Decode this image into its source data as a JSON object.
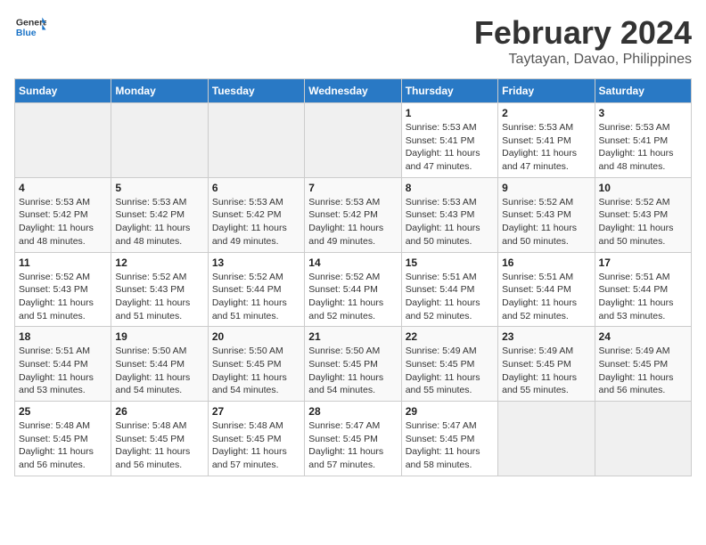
{
  "header": {
    "logo_general": "General",
    "logo_blue": "Blue",
    "month_title": "February 2024",
    "location": "Taytayan, Davao, Philippines"
  },
  "days_of_week": [
    "Sunday",
    "Monday",
    "Tuesday",
    "Wednesday",
    "Thursday",
    "Friday",
    "Saturday"
  ],
  "weeks": [
    [
      {
        "day": "",
        "info": ""
      },
      {
        "day": "",
        "info": ""
      },
      {
        "day": "",
        "info": ""
      },
      {
        "day": "",
        "info": ""
      },
      {
        "day": "1",
        "info": "Sunrise: 5:53 AM\nSunset: 5:41 PM\nDaylight: 11 hours\nand 47 minutes."
      },
      {
        "day": "2",
        "info": "Sunrise: 5:53 AM\nSunset: 5:41 PM\nDaylight: 11 hours\nand 47 minutes."
      },
      {
        "day": "3",
        "info": "Sunrise: 5:53 AM\nSunset: 5:41 PM\nDaylight: 11 hours\nand 48 minutes."
      }
    ],
    [
      {
        "day": "4",
        "info": "Sunrise: 5:53 AM\nSunset: 5:42 PM\nDaylight: 11 hours\nand 48 minutes."
      },
      {
        "day": "5",
        "info": "Sunrise: 5:53 AM\nSunset: 5:42 PM\nDaylight: 11 hours\nand 48 minutes."
      },
      {
        "day": "6",
        "info": "Sunrise: 5:53 AM\nSunset: 5:42 PM\nDaylight: 11 hours\nand 49 minutes."
      },
      {
        "day": "7",
        "info": "Sunrise: 5:53 AM\nSunset: 5:42 PM\nDaylight: 11 hours\nand 49 minutes."
      },
      {
        "day": "8",
        "info": "Sunrise: 5:53 AM\nSunset: 5:43 PM\nDaylight: 11 hours\nand 50 minutes."
      },
      {
        "day": "9",
        "info": "Sunrise: 5:52 AM\nSunset: 5:43 PM\nDaylight: 11 hours\nand 50 minutes."
      },
      {
        "day": "10",
        "info": "Sunrise: 5:52 AM\nSunset: 5:43 PM\nDaylight: 11 hours\nand 50 minutes."
      }
    ],
    [
      {
        "day": "11",
        "info": "Sunrise: 5:52 AM\nSunset: 5:43 PM\nDaylight: 11 hours\nand 51 minutes."
      },
      {
        "day": "12",
        "info": "Sunrise: 5:52 AM\nSunset: 5:43 PM\nDaylight: 11 hours\nand 51 minutes."
      },
      {
        "day": "13",
        "info": "Sunrise: 5:52 AM\nSunset: 5:44 PM\nDaylight: 11 hours\nand 51 minutes."
      },
      {
        "day": "14",
        "info": "Sunrise: 5:52 AM\nSunset: 5:44 PM\nDaylight: 11 hours\nand 52 minutes."
      },
      {
        "day": "15",
        "info": "Sunrise: 5:51 AM\nSunset: 5:44 PM\nDaylight: 11 hours\nand 52 minutes."
      },
      {
        "day": "16",
        "info": "Sunrise: 5:51 AM\nSunset: 5:44 PM\nDaylight: 11 hours\nand 52 minutes."
      },
      {
        "day": "17",
        "info": "Sunrise: 5:51 AM\nSunset: 5:44 PM\nDaylight: 11 hours\nand 53 minutes."
      }
    ],
    [
      {
        "day": "18",
        "info": "Sunrise: 5:51 AM\nSunset: 5:44 PM\nDaylight: 11 hours\nand 53 minutes."
      },
      {
        "day": "19",
        "info": "Sunrise: 5:50 AM\nSunset: 5:44 PM\nDaylight: 11 hours\nand 54 minutes."
      },
      {
        "day": "20",
        "info": "Sunrise: 5:50 AM\nSunset: 5:45 PM\nDaylight: 11 hours\nand 54 minutes."
      },
      {
        "day": "21",
        "info": "Sunrise: 5:50 AM\nSunset: 5:45 PM\nDaylight: 11 hours\nand 54 minutes."
      },
      {
        "day": "22",
        "info": "Sunrise: 5:49 AM\nSunset: 5:45 PM\nDaylight: 11 hours\nand 55 minutes."
      },
      {
        "day": "23",
        "info": "Sunrise: 5:49 AM\nSunset: 5:45 PM\nDaylight: 11 hours\nand 55 minutes."
      },
      {
        "day": "24",
        "info": "Sunrise: 5:49 AM\nSunset: 5:45 PM\nDaylight: 11 hours\nand 56 minutes."
      }
    ],
    [
      {
        "day": "25",
        "info": "Sunrise: 5:48 AM\nSunset: 5:45 PM\nDaylight: 11 hours\nand 56 minutes."
      },
      {
        "day": "26",
        "info": "Sunrise: 5:48 AM\nSunset: 5:45 PM\nDaylight: 11 hours\nand 56 minutes."
      },
      {
        "day": "27",
        "info": "Sunrise: 5:48 AM\nSunset: 5:45 PM\nDaylight: 11 hours\nand 57 minutes."
      },
      {
        "day": "28",
        "info": "Sunrise: 5:47 AM\nSunset: 5:45 PM\nDaylight: 11 hours\nand 57 minutes."
      },
      {
        "day": "29",
        "info": "Sunrise: 5:47 AM\nSunset: 5:45 PM\nDaylight: 11 hours\nand 58 minutes."
      },
      {
        "day": "",
        "info": ""
      },
      {
        "day": "",
        "info": ""
      }
    ]
  ]
}
